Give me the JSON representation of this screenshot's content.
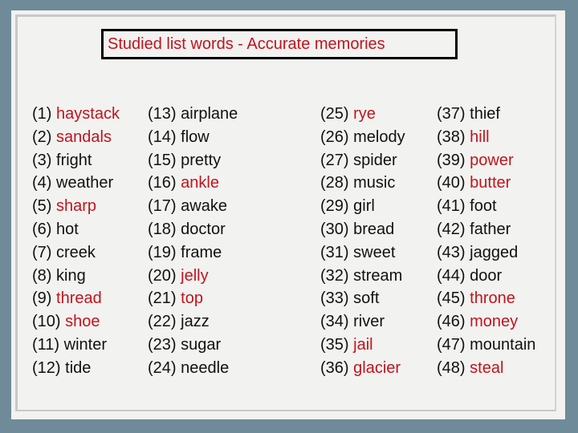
{
  "title": "Studied list words - Accurate memories",
  "colors": {
    "highlight": "#c0141c",
    "normal": "#111111"
  },
  "columns": [
    [
      {
        "num": "(1)",
        "word": "haystack",
        "highlighted": true
      },
      {
        "num": "(2)",
        "word": "sandals",
        "highlighted": true
      },
      {
        "num": "(3)",
        "word": "fright",
        "highlighted": false
      },
      {
        "num": "(4)",
        "word": "weather",
        "highlighted": false
      },
      {
        "num": "(5)",
        "word": "sharp",
        "highlighted": true
      },
      {
        "num": "(6)",
        "word": "hot",
        "highlighted": false
      },
      {
        "num": "(7)",
        "word": "creek",
        "highlighted": false
      },
      {
        "num": "(8)",
        "word": "king",
        "highlighted": false
      },
      {
        "num": "(9)",
        "word": "thread",
        "highlighted": true
      },
      {
        "num": "(10)",
        "word": "shoe",
        "highlighted": true
      },
      {
        "num": "(11)",
        "word": "winter",
        "highlighted": false
      },
      {
        "num": "(12)",
        "word": "tide",
        "highlighted": false
      }
    ],
    [
      {
        "num": "(13)",
        "word": "airplane",
        "highlighted": false
      },
      {
        "num": "(14)",
        "word": "flow",
        "highlighted": false
      },
      {
        "num": "(15)",
        "word": "pretty",
        "highlighted": false
      },
      {
        "num": "(16)",
        "word": "ankle",
        "highlighted": true
      },
      {
        "num": "(17)",
        "word": "awake",
        "highlighted": false
      },
      {
        "num": "(18)",
        "word": "doctor",
        "highlighted": false
      },
      {
        "num": "(19)",
        "word": "frame",
        "highlighted": false
      },
      {
        "num": "(20)",
        "word": "jelly",
        "highlighted": true
      },
      {
        "num": "(21)",
        "word": "top",
        "highlighted": true
      },
      {
        "num": "(22)",
        "word": "jazz",
        "highlighted": false
      },
      {
        "num": "(23)",
        "word": "sugar",
        "highlighted": false
      },
      {
        "num": "(24)",
        "word": "needle",
        "highlighted": false
      }
    ],
    [
      {
        "num": "(25)",
        "word": "rye",
        "highlighted": true
      },
      {
        "num": "(26)",
        "word": "melody",
        "highlighted": false
      },
      {
        "num": "(27)",
        "word": "spider",
        "highlighted": false
      },
      {
        "num": "(28)",
        "word": "music",
        "highlighted": false
      },
      {
        "num": "(29)",
        "word": "girl",
        "highlighted": false
      },
      {
        "num": "(30)",
        "word": "bread",
        "highlighted": false
      },
      {
        "num": "(31)",
        "word": "sweet",
        "highlighted": false
      },
      {
        "num": "(32)",
        "word": "stream",
        "highlighted": false
      },
      {
        "num": "(33)",
        "word": "soft",
        "highlighted": false
      },
      {
        "num": "(34)",
        "word": "river",
        "highlighted": false
      },
      {
        "num": "(35)",
        "word": "jail",
        "highlighted": true
      },
      {
        "num": "(36)",
        "word": "glacier",
        "highlighted": true
      }
    ],
    [
      {
        "num": "(37)",
        "word": "thief",
        "highlighted": false
      },
      {
        "num": "(38)",
        "word": "hill",
        "highlighted": true
      },
      {
        "num": "(39)",
        "word": "power",
        "highlighted": true
      },
      {
        "num": "(40)",
        "word": "butter",
        "highlighted": true
      },
      {
        "num": "(41)",
        "word": "foot",
        "highlighted": false
      },
      {
        "num": "(42)",
        "word": "father",
        "highlighted": false
      },
      {
        "num": "(43)",
        "word": "jagged",
        "highlighted": false
      },
      {
        "num": "(44)",
        "word": "door",
        "highlighted": false
      },
      {
        "num": "(45)",
        "word": "throne",
        "highlighted": true
      },
      {
        "num": "(46)",
        "word": "money",
        "highlighted": true
      },
      {
        "num": "(47)",
        "word": "mountain",
        "highlighted": false
      },
      {
        "num": "(48)",
        "word": "steal",
        "highlighted": true
      }
    ]
  ]
}
